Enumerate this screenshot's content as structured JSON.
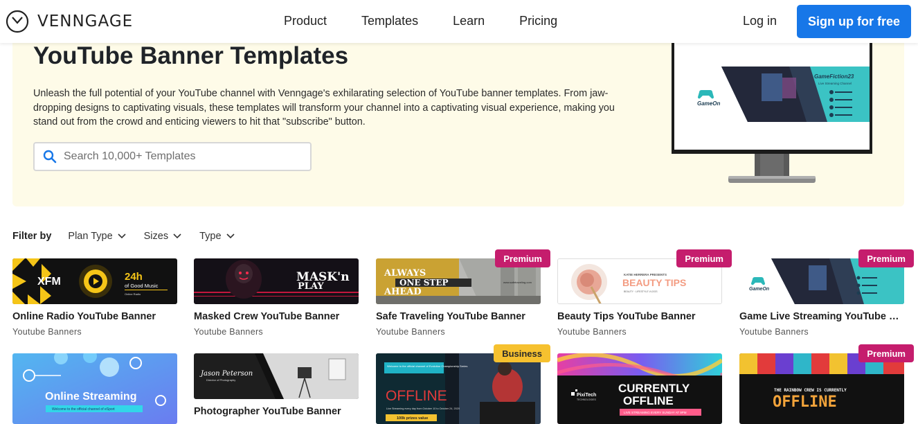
{
  "nav": {
    "brand": "VENNGAGE",
    "links": [
      "Product",
      "Templates",
      "Learn",
      "Pricing"
    ],
    "login": "Log in",
    "signup": "Sign up for free"
  },
  "hero": {
    "title": "YouTube Banner Templates",
    "description": "Unleash the full potential of your YouTube channel with Venngage's exhilarating selection of YouTube banner templates. From jaw-dropping designs to captivating visuals, these templates will transform your channel into a captivating visual experience, making you stand out from the crowd and enticing viewers to hit that \"subscribe\" button.",
    "search_placeholder": "Search 10,000+ Templates",
    "preview": {
      "brand": "GameOn",
      "channel": "GameFiction23",
      "tagline": "Live Streaming Channel"
    }
  },
  "filters": {
    "label": "Filter by",
    "options": [
      "Plan Type",
      "Sizes",
      "Type"
    ]
  },
  "cards_row1": [
    {
      "title": "Online Radio YouTube Banner",
      "category": "Youtube Banners",
      "badge": "",
      "thumb_text": {
        "brand": "XFM",
        "hours": "24h",
        "tag": "of Good Music",
        "small": "Online Radio"
      }
    },
    {
      "title": "Masked Crew YouTube Banner",
      "category": "Youtube Banners",
      "badge": "",
      "thumb_text": {
        "line1": "MASK'n",
        "line2": "PLAY"
      }
    },
    {
      "title": "Safe Traveling YouTube Banner",
      "category": "Youtube Banners",
      "badge": "Premium",
      "thumb_text": {
        "line1": "ALWAYS",
        "line2": "ONE STEP",
        "line3": "AHEAD",
        "site": "www.safetraveling.com"
      }
    },
    {
      "title": "Beauty Tips YouTube Banner",
      "category": "Youtube Banners",
      "badge": "Premium",
      "thumb_text": {
        "presenter": "KATIE HERRERA PRESENTS",
        "headline": "BEAUTY TIPS",
        "small": "BEAUTY · LIFESTYLE VLOGS"
      }
    },
    {
      "title": "Game Live Streaming YouTube Banner",
      "category": "Youtube Banners",
      "badge": "Premium",
      "thumb_text": {
        "brand": "GameOn"
      }
    }
  ],
  "cards_row2": [
    {
      "title": "",
      "category": "",
      "badge": "",
      "thumb_text": {
        "headline": "Online Streaming",
        "small": "Welcome to the official channel of eSport"
      }
    },
    {
      "title": "Photographer YouTube Banner",
      "category": "",
      "badge": "",
      "thumb_text": {
        "name": "Jason Peterson",
        "role": "Director of Photography"
      }
    },
    {
      "title": "",
      "category": "",
      "badge": "Business",
      "thumb_text": {
        "intro": "Welcome to the official channel of Evolution Championship Series",
        "headline": "OFFLINE",
        "small": "Live Streaming every day from October 10 to October 24, 2020",
        "prize": "100k prizes value"
      }
    },
    {
      "title": "",
      "category": "",
      "badge": "",
      "thumb_text": {
        "brand": "PixiTech",
        "brand_sub": "TECHNOLOGIES",
        "line1": "CURRENTLY",
        "line2": "OFFLINE",
        "strip": "LIVE STREAMING EVERY SUNDAY AT 9PM"
      }
    },
    {
      "title": "",
      "category": "",
      "badge": "Premium",
      "thumb_text": {
        "line": "THE RAINBOW CREW IS CURRENTLY",
        "headline": "OFFLINE"
      }
    }
  ]
}
